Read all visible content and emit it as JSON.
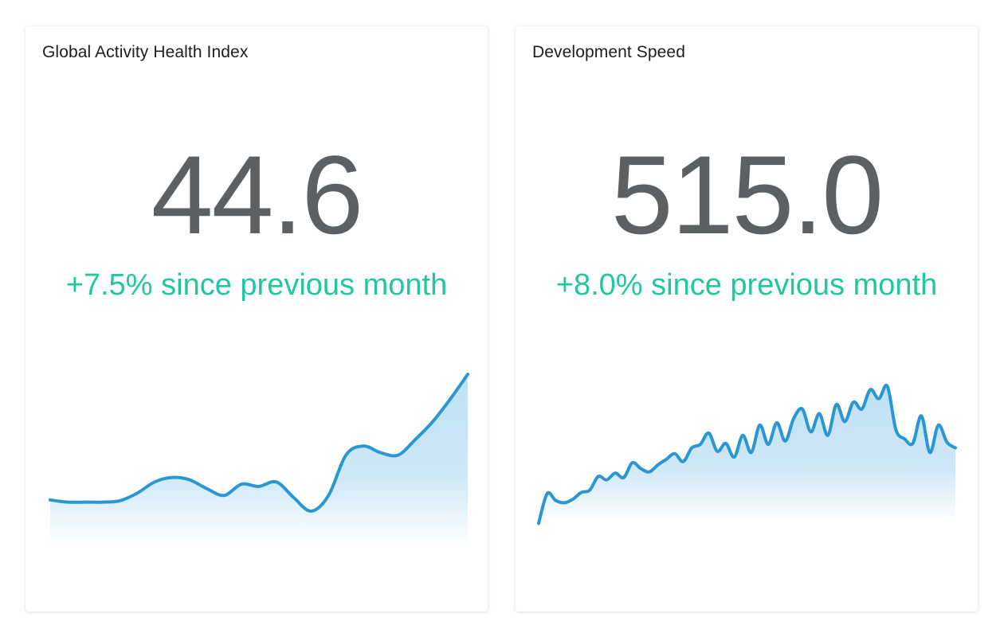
{
  "colors": {
    "accent_green": "#22c7a0",
    "value_gray": "#5d6063",
    "line_blue": "#2a97d4",
    "fill_blue": "#bfe0f4"
  },
  "cards": [
    {
      "title": "Global Activity Health Index",
      "value": "44.6",
      "change": "+7.5% since previous month"
    },
    {
      "title": "Development Speed",
      "value": "515.0",
      "change": "+8.0% since previous month"
    }
  ],
  "chart_data": [
    {
      "type": "area",
      "values": [
        10,
        9,
        9,
        9,
        9.6,
        13,
        18,
        20,
        19,
        15,
        12,
        17,
        16,
        18,
        11,
        5,
        12,
        30,
        34,
        31,
        30,
        37,
        45,
        55,
        66
      ]
    },
    {
      "type": "line",
      "values": [
        4,
        30,
        24,
        22,
        25,
        31,
        33,
        45,
        42,
        48,
        44,
        57,
        52,
        49,
        55,
        60,
        65,
        58,
        70,
        73,
        83,
        67,
        74,
        62,
        81,
        66,
        90,
        73,
        92,
        76,
        96,
        104,
        84,
        100,
        81,
        108,
        93,
        110,
        104,
        121,
        113,
        124,
        86,
        78,
        74,
        98,
        66,
        90,
        75,
        70
      ]
    }
  ]
}
